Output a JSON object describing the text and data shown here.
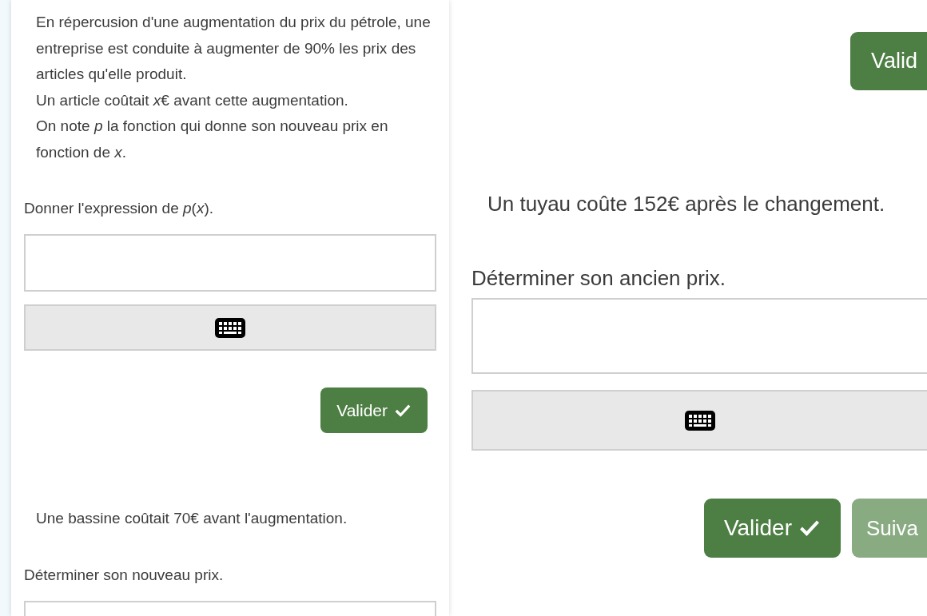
{
  "left_panel": {
    "statement": [
      "En répercusion d'une augmentation du prix du pétrole, une entreprise est conduite à augmenter de 90% les prix des articles qu'elle produit.",
      "Un article coûtait *x*€ avant cette augmentation.",
      "On note *p* la fonction qui donne son nouveau prix en fonction de *x*."
    ],
    "question_1": {
      "prompt": "Donner l'expression de *p*(*x*).",
      "button": "Valider"
    },
    "context_2": "Une bassine coûtait 70€ avant l'augmentation.",
    "question_2": {
      "prompt": "Déterminer son nouveau prix."
    }
  },
  "right_panel": {
    "top_button": "Valid",
    "context": "Un tuyau coûte 152€ après le changement.",
    "question": {
      "prompt": "Déterminer son ancien prix.",
      "button": "Valider"
    },
    "next_button": {
      "label": "Suiva",
      "disabled": true
    }
  }
}
